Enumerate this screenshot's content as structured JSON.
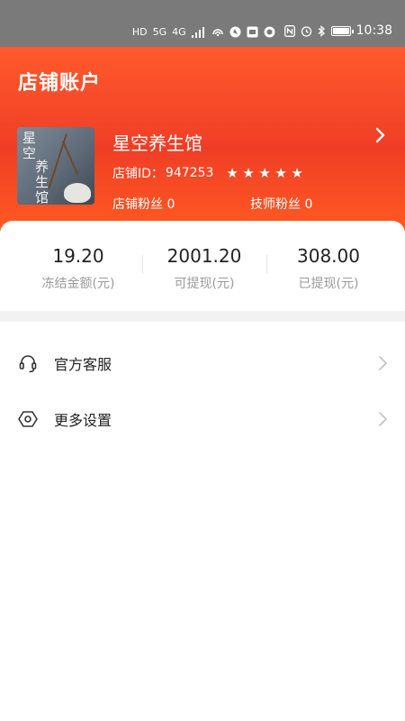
{
  "status_bar": {
    "left_icons": [
      "HD",
      "5G",
      "4G"
    ],
    "time": "10:38",
    "icons": [
      "hd-icon",
      "signal-icon",
      "hotspot-icon",
      "nfc-icon",
      "alarm-icon",
      "bluetooth-icon",
      "battery-icon"
    ]
  },
  "header": {
    "title": "店铺账户",
    "store": {
      "name": "星空养生馆",
      "logo_text_top": "星空",
      "logo_text_bottom": "养生馆",
      "id_label": "店铺ID：",
      "id_value": "947253",
      "rating": 5,
      "store_fans": "店铺粉丝 0",
      "tech_fans": "技师粉丝 0"
    },
    "gradient_colors": [
      "#ff5a2c",
      "#f03e26"
    ]
  },
  "stats": [
    {
      "value": "19.20",
      "label": "冻结金额(元)"
    },
    {
      "value": "2001.20",
      "label": "可提现(元)"
    },
    {
      "value": "308.00",
      "label": "已提现(元)"
    }
  ],
  "menu": [
    {
      "label": "官方客服",
      "icon": "headset-icon"
    },
    {
      "label": "更多设置",
      "icon": "settings-hexagon-icon"
    }
  ]
}
